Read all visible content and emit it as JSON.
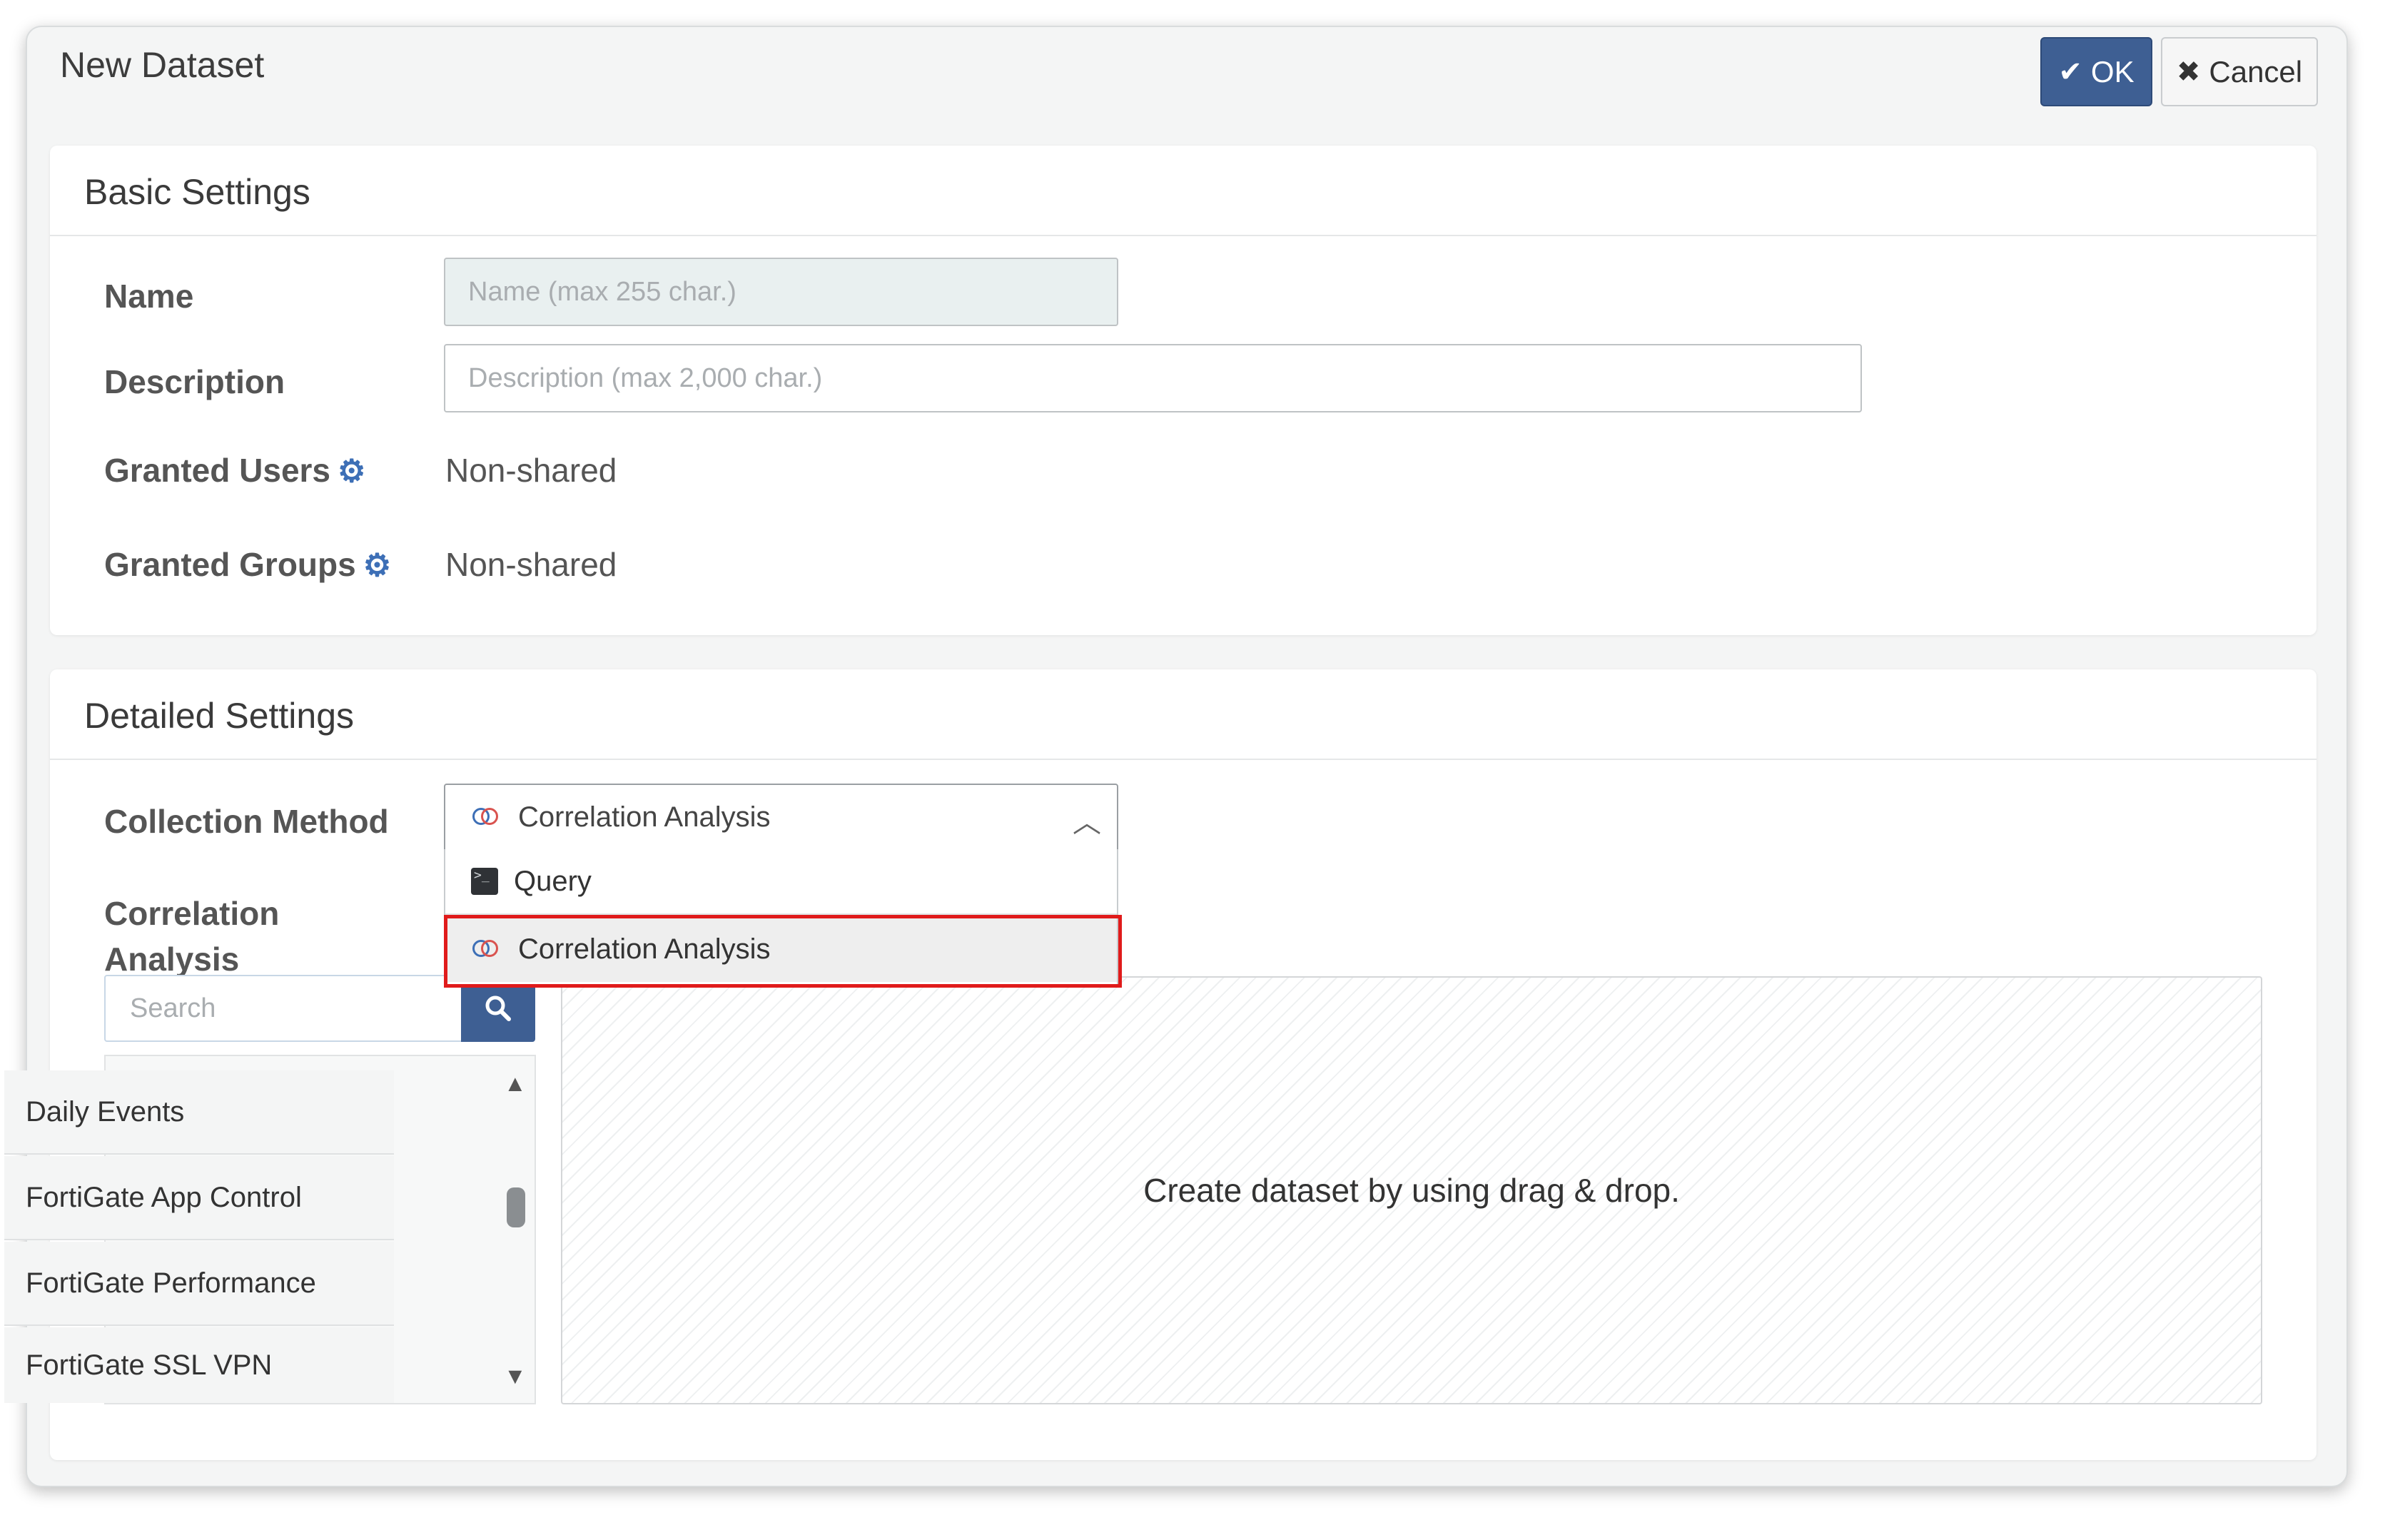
{
  "dialog": {
    "title": "New Dataset",
    "ok_label": "OK",
    "cancel_label": "Cancel"
  },
  "basic_settings": {
    "heading": "Basic Settings",
    "name_label": "Name",
    "name_placeholder": "Name (max 255 char.)",
    "description_label": "Description",
    "description_placeholder": "Description (max 2,000 char.)",
    "granted_users_label": "Granted Users",
    "granted_users_value": "Non-shared",
    "granted_groups_label": "Granted Groups",
    "granted_groups_value": "Non-shared"
  },
  "detailed_settings": {
    "heading": "Detailed Settings",
    "collection_method_label": "Collection Method",
    "collection_method_selected": "Correlation Analysis",
    "collection_method_options": [
      "Query",
      "Correlation Analysis"
    ],
    "correlation_label_line1": "Correlation",
    "correlation_label_line2": "Analysis",
    "search_placeholder": "Search",
    "list_items": [
      "Daily Events",
      "FortiGate App Control",
      "FortiGate Performance",
      "FortiGate SSL VPN"
    ],
    "drop_hint": "Create dataset by using drag & drop."
  },
  "icons": {
    "ok": "check-icon",
    "cancel": "close-icon",
    "gear": "gear-icon",
    "search": "search-icon",
    "correlation": "correlation-icon",
    "query": "terminal-icon"
  },
  "colors": {
    "primary": "#3e5f93",
    "gear_accent": "#3d6fb6",
    "highlight": "#e01b1b"
  }
}
